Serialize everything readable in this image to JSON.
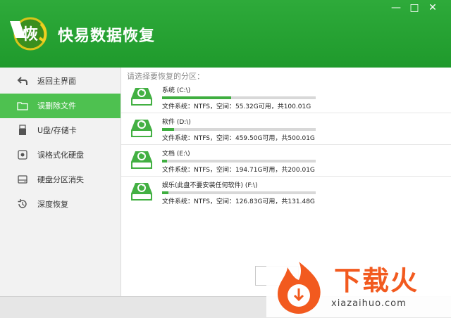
{
  "app": {
    "title": "快易数据恢复",
    "logo_char": "恢"
  },
  "window_controls": {
    "minimize": "—",
    "maximize": "□",
    "close": "✕"
  },
  "sidebar": {
    "items": [
      {
        "label": "返回主界面",
        "icon": "back-arrow-icon",
        "active": false
      },
      {
        "label": "误删除文件",
        "icon": "folder-icon",
        "active": true
      },
      {
        "label": "U盘/存储卡",
        "icon": "usb-drive-icon",
        "active": false
      },
      {
        "label": "误格式化硬盘",
        "icon": "format-disk-icon",
        "active": false
      },
      {
        "label": "硬盘分区消失",
        "icon": "partition-disk-icon",
        "active": false
      },
      {
        "label": "深度恢复",
        "icon": "deep-recover-icon",
        "active": false
      }
    ]
  },
  "main": {
    "hint": "请选择要恢复的分区：",
    "partitions": [
      {
        "name": "系统 (C:\\)",
        "info": "文件系统：NTFS，空间：55.32G可用，共100.01G",
        "used_fraction": 0.45
      },
      {
        "name": "软件 (D:\\)",
        "info": "文件系统：NTFS，空间：459.50G可用，共500.01G",
        "used_fraction": 0.08
      },
      {
        "name": "文档 (E:\\)",
        "info": "文件系统：NTFS，空间：194.71G可用，共200.01G",
        "used_fraction": 0.03
      },
      {
        "name": "娱乐(此盘不要安装任何软件) (F:\\)",
        "info": "文件系统：NTFS，空间：126.83G可用，共131.48G",
        "used_fraction": 0.04
      }
    ]
  },
  "watermark": {
    "text": "下载火",
    "url": "xiazaihuo.com"
  },
  "colors": {
    "brand_green": "#2eaa3a",
    "active_green": "#4ec150",
    "bar_green": "#3fae40",
    "watermark_orange": "#f25a1f"
  }
}
